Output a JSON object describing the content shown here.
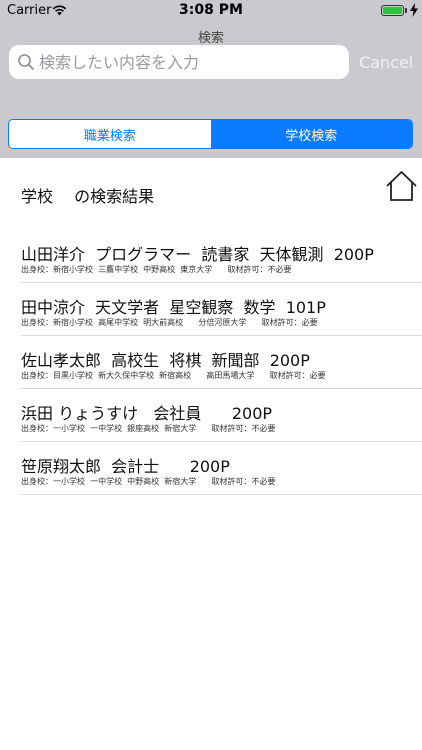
{
  "status_bar": {
    "carrier": "Carrier",
    "time": "3:08 PM",
    "battery_level": 1.0,
    "battery_color": "#2bc43c"
  },
  "nav": {
    "title": "検索",
    "search_placeholder": "検索したい内容を入力",
    "cancel_label": "Cancel"
  },
  "segments": {
    "job_search": "職業検索",
    "school_search": "学校検索",
    "selected": "school_search",
    "accent_color": "#0a7bff"
  },
  "results": {
    "header": "学校　 の検索結果",
    "home_icon": "home-icon",
    "rows": [
      {
        "main": "山田洋介  プログラマー  読書家  天体観測  200P",
        "sub": "出身校：新宿小学校  三鷹中学校  中野高校  東京大学      取材許可：不必要"
      },
      {
        "main": "田中涼介  天文学者  星空観察  数学  101P",
        "sub": "出身校：新宿小学校  高尾中学校  明大前高校      分倍河原大学      取材許可：必要"
      },
      {
        "main": "佐山孝太郎  高校生  将棋  新聞部  200P",
        "sub": "出身校：目黒小学校  新大久保中学校  新宿高校      高田馬場大学      取材許可：必要"
      },
      {
        "main": "浜田 りょうすけ   会社員      200P",
        "sub": "出身校：一小学校  一中学校  銀座高校  新宿大学      取材許可：不必要"
      },
      {
        "main": "笹原翔太郎  会計士      200P",
        "sub": "出身校：一小学校  一中学校  中野高校  新宿大学      取材許可：不必要"
      }
    ]
  }
}
